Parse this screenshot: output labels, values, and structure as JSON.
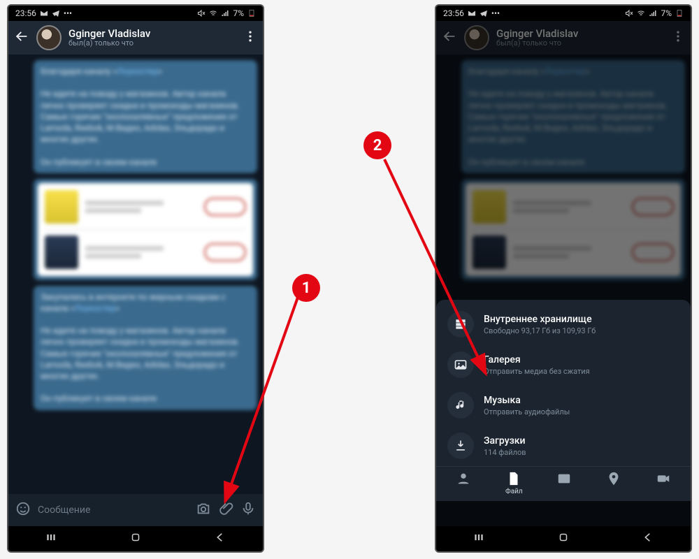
{
  "status": {
    "time": "23:56",
    "battery": "7%"
  },
  "header": {
    "name": "Gginger Vladislav",
    "sub": "был(а) только что"
  },
  "chat": {
    "blurb1_a": "благодаря каналу «",
    "blurb1_link": "Лоукостер",
    "blurb1_b": "»",
    "blurb1_body": "Не идите на поводу у магазинов. Автор канала лично проверяет скидки и промокоды магазинов. Самые горячие \"околохалявные\" предложения от Lamoda, Reebok, М.Видео, Adidas, Эльдорадо и многих других.",
    "blurb1_foot": "Он публикует в своем канале",
    "blurb2_a": "Закупались в интернете по жирным скидкам с канала «",
    "blurb2_link": "Лоукостер",
    "blurb2_b": "»"
  },
  "input": {
    "placeholder": "Сообщение"
  },
  "sheet": {
    "items": [
      {
        "title": "Внутреннее хранилище",
        "subtitle": "Свободно 93,17 Гб из 109,93 Гб"
      },
      {
        "title": "Галерея",
        "subtitle": "Отправить медиа без сжатия"
      },
      {
        "title": "Музыка",
        "subtitle": "Отправить аудиофайлы"
      },
      {
        "title": "Загрузки",
        "subtitle": "114 файлов"
      }
    ],
    "active_tab_label": "Файл"
  },
  "annotations": {
    "b1": "1",
    "b2": "2"
  }
}
